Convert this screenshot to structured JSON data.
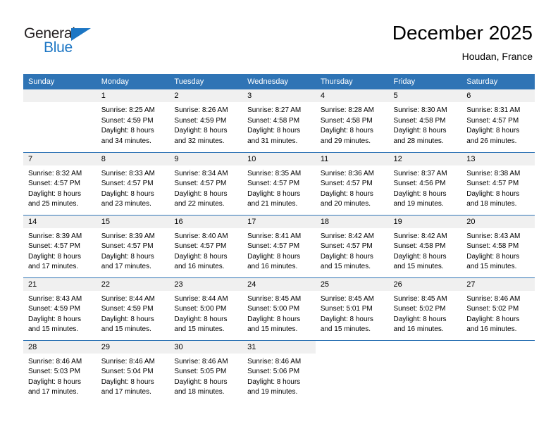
{
  "brand": {
    "name_top": "General",
    "name_bottom": "Blue",
    "accent_color": "#1c76c4"
  },
  "header": {
    "month_year": "December 2025",
    "location": "Houdan, France"
  },
  "calendar": {
    "header_color": "#2f74b5",
    "daynum_band_color": "#f0f0f0",
    "weekday_headers": [
      "Sunday",
      "Monday",
      "Tuesday",
      "Wednesday",
      "Thursday",
      "Friday",
      "Saturday"
    ],
    "weeks": [
      [
        {
          "day": "",
          "lines": [],
          "blank": true
        },
        {
          "day": "1",
          "lines": [
            "Sunrise: 8:25 AM",
            "Sunset: 4:59 PM",
            "Daylight: 8 hours",
            "and 34 minutes."
          ]
        },
        {
          "day": "2",
          "lines": [
            "Sunrise: 8:26 AM",
            "Sunset: 4:59 PM",
            "Daylight: 8 hours",
            "and 32 minutes."
          ]
        },
        {
          "day": "3",
          "lines": [
            "Sunrise: 8:27 AM",
            "Sunset: 4:58 PM",
            "Daylight: 8 hours",
            "and 31 minutes."
          ]
        },
        {
          "day": "4",
          "lines": [
            "Sunrise: 8:28 AM",
            "Sunset: 4:58 PM",
            "Daylight: 8 hours",
            "and 29 minutes."
          ]
        },
        {
          "day": "5",
          "lines": [
            "Sunrise: 8:30 AM",
            "Sunset: 4:58 PM",
            "Daylight: 8 hours",
            "and 28 minutes."
          ]
        },
        {
          "day": "6",
          "lines": [
            "Sunrise: 8:31 AM",
            "Sunset: 4:57 PM",
            "Daylight: 8 hours",
            "and 26 minutes."
          ]
        }
      ],
      [
        {
          "day": "7",
          "lines": [
            "Sunrise: 8:32 AM",
            "Sunset: 4:57 PM",
            "Daylight: 8 hours",
            "and 25 minutes."
          ]
        },
        {
          "day": "8",
          "lines": [
            "Sunrise: 8:33 AM",
            "Sunset: 4:57 PM",
            "Daylight: 8 hours",
            "and 23 minutes."
          ]
        },
        {
          "day": "9",
          "lines": [
            "Sunrise: 8:34 AM",
            "Sunset: 4:57 PM",
            "Daylight: 8 hours",
            "and 22 minutes."
          ]
        },
        {
          "day": "10",
          "lines": [
            "Sunrise: 8:35 AM",
            "Sunset: 4:57 PM",
            "Daylight: 8 hours",
            "and 21 minutes."
          ]
        },
        {
          "day": "11",
          "lines": [
            "Sunrise: 8:36 AM",
            "Sunset: 4:57 PM",
            "Daylight: 8 hours",
            "and 20 minutes."
          ]
        },
        {
          "day": "12",
          "lines": [
            "Sunrise: 8:37 AM",
            "Sunset: 4:56 PM",
            "Daylight: 8 hours",
            "and 19 minutes."
          ]
        },
        {
          "day": "13",
          "lines": [
            "Sunrise: 8:38 AM",
            "Sunset: 4:57 PM",
            "Daylight: 8 hours",
            "and 18 minutes."
          ]
        }
      ],
      [
        {
          "day": "14",
          "lines": [
            "Sunrise: 8:39 AM",
            "Sunset: 4:57 PM",
            "Daylight: 8 hours",
            "and 17 minutes."
          ]
        },
        {
          "day": "15",
          "lines": [
            "Sunrise: 8:39 AM",
            "Sunset: 4:57 PM",
            "Daylight: 8 hours",
            "and 17 minutes."
          ]
        },
        {
          "day": "16",
          "lines": [
            "Sunrise: 8:40 AM",
            "Sunset: 4:57 PM",
            "Daylight: 8 hours",
            "and 16 minutes."
          ]
        },
        {
          "day": "17",
          "lines": [
            "Sunrise: 8:41 AM",
            "Sunset: 4:57 PM",
            "Daylight: 8 hours",
            "and 16 minutes."
          ]
        },
        {
          "day": "18",
          "lines": [
            "Sunrise: 8:42 AM",
            "Sunset: 4:57 PM",
            "Daylight: 8 hours",
            "and 15 minutes."
          ]
        },
        {
          "day": "19",
          "lines": [
            "Sunrise: 8:42 AM",
            "Sunset: 4:58 PM",
            "Daylight: 8 hours",
            "and 15 minutes."
          ]
        },
        {
          "day": "20",
          "lines": [
            "Sunrise: 8:43 AM",
            "Sunset: 4:58 PM",
            "Daylight: 8 hours",
            "and 15 minutes."
          ]
        }
      ],
      [
        {
          "day": "21",
          "lines": [
            "Sunrise: 8:43 AM",
            "Sunset: 4:59 PM",
            "Daylight: 8 hours",
            "and 15 minutes."
          ]
        },
        {
          "day": "22",
          "lines": [
            "Sunrise: 8:44 AM",
            "Sunset: 4:59 PM",
            "Daylight: 8 hours",
            "and 15 minutes."
          ]
        },
        {
          "day": "23",
          "lines": [
            "Sunrise: 8:44 AM",
            "Sunset: 5:00 PM",
            "Daylight: 8 hours",
            "and 15 minutes."
          ]
        },
        {
          "day": "24",
          "lines": [
            "Sunrise: 8:45 AM",
            "Sunset: 5:00 PM",
            "Daylight: 8 hours",
            "and 15 minutes."
          ]
        },
        {
          "day": "25",
          "lines": [
            "Sunrise: 8:45 AM",
            "Sunset: 5:01 PM",
            "Daylight: 8 hours",
            "and 15 minutes."
          ]
        },
        {
          "day": "26",
          "lines": [
            "Sunrise: 8:45 AM",
            "Sunset: 5:02 PM",
            "Daylight: 8 hours",
            "and 16 minutes."
          ]
        },
        {
          "day": "27",
          "lines": [
            "Sunrise: 8:46 AM",
            "Sunset: 5:02 PM",
            "Daylight: 8 hours",
            "and 16 minutes."
          ]
        }
      ],
      [
        {
          "day": "28",
          "lines": [
            "Sunrise: 8:46 AM",
            "Sunset: 5:03 PM",
            "Daylight: 8 hours",
            "and 17 minutes."
          ]
        },
        {
          "day": "29",
          "lines": [
            "Sunrise: 8:46 AM",
            "Sunset: 5:04 PM",
            "Daylight: 8 hours",
            "and 17 minutes."
          ]
        },
        {
          "day": "30",
          "lines": [
            "Sunrise: 8:46 AM",
            "Sunset: 5:05 PM",
            "Daylight: 8 hours",
            "and 18 minutes."
          ]
        },
        {
          "day": "31",
          "lines": [
            "Sunrise: 8:46 AM",
            "Sunset: 5:06 PM",
            "Daylight: 8 hours",
            "and 19 minutes."
          ]
        },
        {
          "day": "",
          "lines": [],
          "blank": true
        },
        {
          "day": "",
          "lines": [],
          "blank": true
        },
        {
          "day": "",
          "lines": [],
          "blank": true
        }
      ]
    ]
  }
}
